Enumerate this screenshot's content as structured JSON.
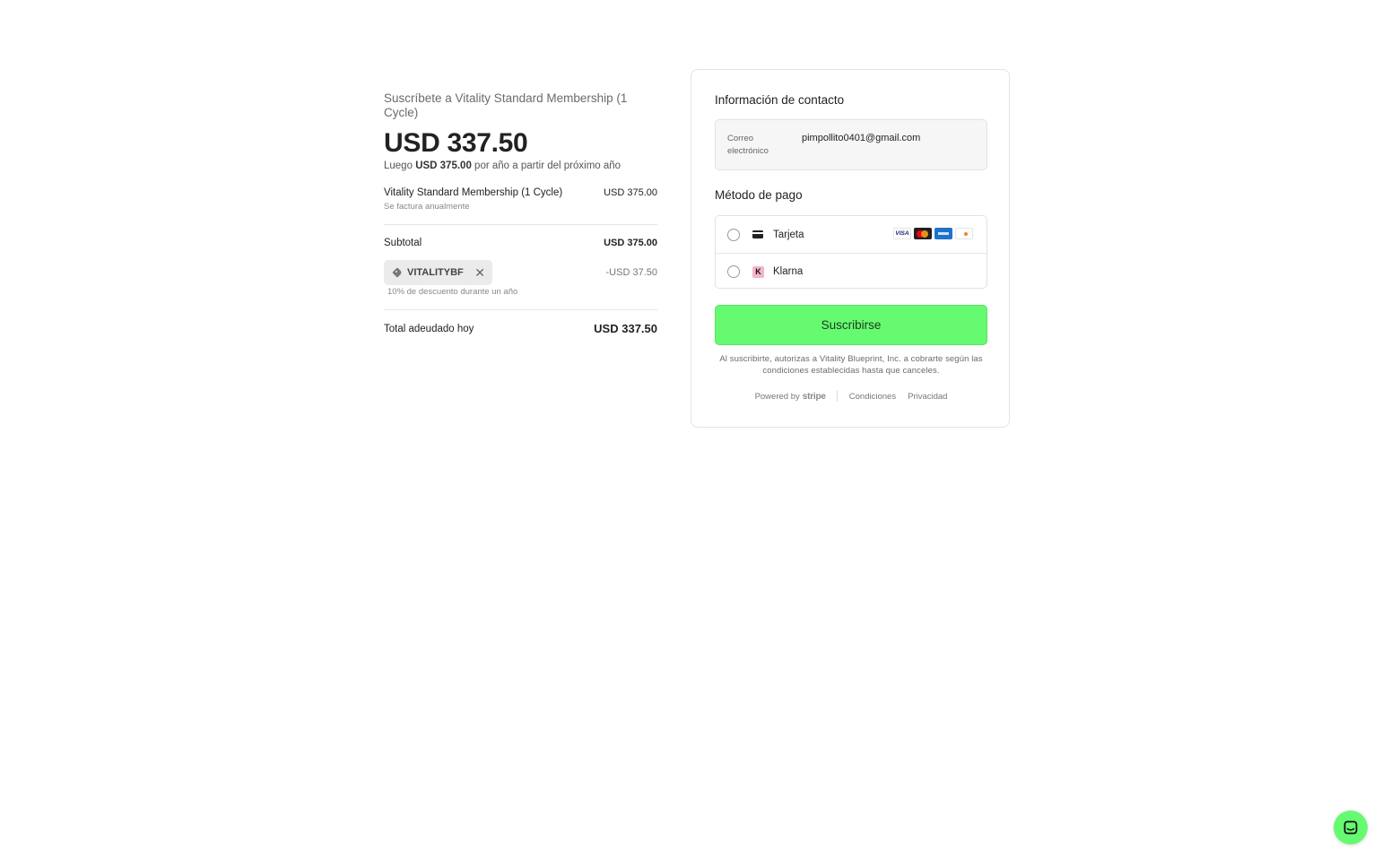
{
  "summary": {
    "title": "Suscríbete a Vitality Standard Membership (1 Cycle)",
    "price": "USD 337.50",
    "then_prefix": "Luego",
    "then_amount": "USD 375.00",
    "then_suffix": "por año a partir del próximo año",
    "line_item": {
      "name": "Vitality Standard Membership (1 Cycle)",
      "billing": "Se factura anualmente",
      "amount": "USD 375.00"
    },
    "subtotal_label": "Subtotal",
    "subtotal_amount": "USD 375.00",
    "promo": {
      "code": "VITALITYBF",
      "remove": "✕",
      "amount": "-USD 37.50",
      "description": "10% de descuento durante un año"
    },
    "total_label": "Total adeudado hoy",
    "total_amount": "USD 337.50"
  },
  "checkout": {
    "contact_title": "Información de contacto",
    "email_label": "Correo electrónico",
    "email_value": "pimpollito0401@gmail.com",
    "payment_title": "Método de pago",
    "payment_options": [
      {
        "label": "Tarjeta",
        "icon": "credit-card-icon",
        "brands": [
          "VISA",
          "Mastercard",
          "American Express",
          "DISCOVER"
        ]
      },
      {
        "label": "Klarna",
        "icon": "klarna-icon",
        "glyph": "K"
      }
    ],
    "subscribe_label": "Suscribirse",
    "legal": "Al suscribirte, autorizas a Vitality Blueprint, Inc. a cobrarte según las condiciones establecidas hasta que canceles.",
    "powered_by": "Powered by",
    "stripe": "stripe",
    "terms": "Condiciones",
    "privacy": "Privacidad"
  },
  "colors": {
    "accent": "#66fa70",
    "card_border": "#e3e3e3"
  },
  "chat": {
    "icon": "chat-icon"
  }
}
